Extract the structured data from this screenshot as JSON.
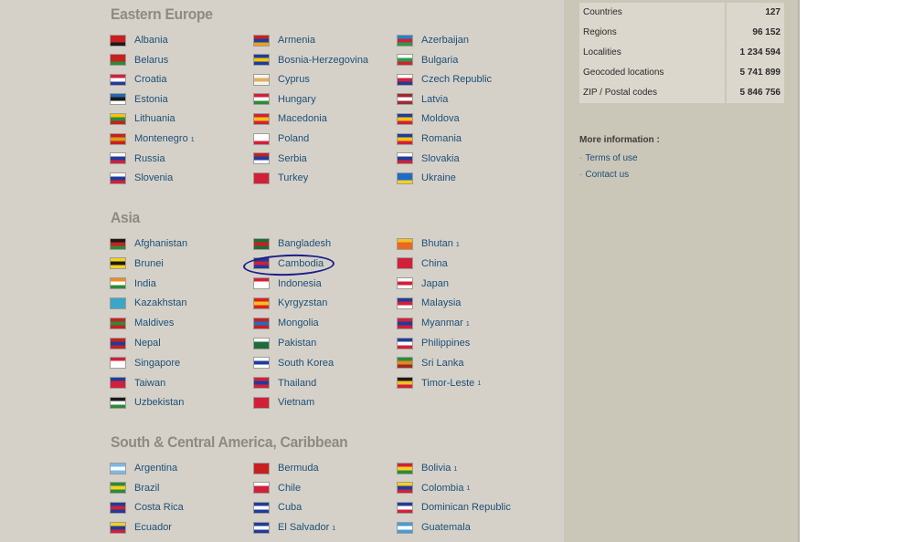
{
  "sections": [
    {
      "title": "Eastern Europe",
      "countries": [
        {
          "name": "Albania",
          "flag": "albania-flag-icon",
          "colors": [
            "#c8201e",
            "#c8201e",
            "#1a1a1a"
          ]
        },
        {
          "name": "Armenia",
          "flag": "armenia-flag-icon",
          "colors": [
            "#c8201e",
            "#1f3c9a",
            "#e8a020"
          ]
        },
        {
          "name": "Azerbaijan",
          "flag": "azerbaijan-flag-icon",
          "colors": [
            "#1f86c6",
            "#d1203a",
            "#2c9a47"
          ]
        },
        {
          "name": "Belarus",
          "flag": "belarus-flag-icon",
          "colors": [
            "#c8201e",
            "#c8201e",
            "#2c8a3a"
          ]
        },
        {
          "name": "Bosnia-Herzegovina",
          "flag": "bosnia-flag-icon",
          "colors": [
            "#1f3c9a",
            "#f1c40f",
            "#1f3c9a"
          ]
        },
        {
          "name": "Bulgaria",
          "flag": "bulgaria-flag-icon",
          "colors": [
            "#ffffff",
            "#2c9a47",
            "#d1203a"
          ]
        },
        {
          "name": "Croatia",
          "flag": "croatia-flag-icon",
          "colors": [
            "#d1203a",
            "#ffffff",
            "#1f3c9a"
          ]
        },
        {
          "name": "Cyprus",
          "flag": "cyprus-flag-icon",
          "colors": [
            "#f5f5ef",
            "#e0b060",
            "#f5f5ef"
          ]
        },
        {
          "name": "Czech Republic",
          "flag": "czech-flag-icon",
          "colors": [
            "#ffffff",
            "#d1203a",
            "#1f3c9a"
          ]
        },
        {
          "name": "Estonia",
          "flag": "estonia-flag-icon",
          "colors": [
            "#1f6cb4",
            "#1a1a1a",
            "#ffffff"
          ]
        },
        {
          "name": "Hungary",
          "flag": "hungary-flag-icon",
          "colors": [
            "#d1203a",
            "#ffffff",
            "#2c8a3a"
          ]
        },
        {
          "name": "Latvia",
          "flag": "latvia-flag-icon",
          "colors": [
            "#9b2a32",
            "#ffffff",
            "#9b2a32"
          ]
        },
        {
          "name": "Lithuania",
          "flag": "lithuania-flag-icon",
          "colors": [
            "#f1c40f",
            "#2c8a3a",
            "#c8201e"
          ]
        },
        {
          "name": "Macedonia",
          "flag": "macedonia-flag-icon",
          "colors": [
            "#d1203a",
            "#f1c40f",
            "#d1203a"
          ]
        },
        {
          "name": "Moldova",
          "flag": "moldova-flag-icon",
          "colors": [
            "#1f3c9a",
            "#f1c40f",
            "#d1203a"
          ]
        },
        {
          "name": "Montenegro",
          "sup": "1",
          "flag": "montenegro-flag-icon",
          "colors": [
            "#c8201e",
            "#d4a017",
            "#c8201e"
          ]
        },
        {
          "name": "Poland",
          "flag": "poland-flag-icon",
          "colors": [
            "#ffffff",
            "#ffffff",
            "#d1203a"
          ]
        },
        {
          "name": "Romania",
          "flag": "romania-flag-icon",
          "colors": [
            "#1f3c9a",
            "#f1c40f",
            "#d1203a"
          ]
        },
        {
          "name": "Russia",
          "flag": "russia-flag-icon",
          "colors": [
            "#ffffff",
            "#1f3c9a",
            "#d1203a"
          ]
        },
        {
          "name": "Serbia",
          "flag": "serbia-flag-icon",
          "colors": [
            "#c8201e",
            "#1f3c9a",
            "#ffffff"
          ]
        },
        {
          "name": "Slovakia",
          "flag": "slovakia-flag-icon",
          "colors": [
            "#ffffff",
            "#1f3c9a",
            "#d1203a"
          ]
        },
        {
          "name": "Slovenia",
          "flag": "slovenia-flag-icon",
          "colors": [
            "#ffffff",
            "#1f3c9a",
            "#d1203a"
          ]
        },
        {
          "name": "Turkey",
          "flag": "turkey-flag-icon",
          "colors": [
            "#d1203a",
            "#d1203a",
            "#d1203a"
          ]
        },
        {
          "name": "Ukraine",
          "flag": "ukraine-flag-icon",
          "colors": [
            "#1f6cc6",
            "#1f6cc6",
            "#f5d020"
          ]
        }
      ]
    },
    {
      "title": "Asia",
      "countries": [
        {
          "name": "Afghanistan",
          "flag": "afghanistan-flag-icon",
          "colors": [
            "#1a1a1a",
            "#c8201e",
            "#2c8a3a"
          ]
        },
        {
          "name": "Bangladesh",
          "flag": "bangladesh-flag-icon",
          "colors": [
            "#1f6b3a",
            "#c8201e",
            "#1f6b3a"
          ]
        },
        {
          "name": "Bhutan",
          "sup": "1",
          "flag": "bhutan-flag-icon",
          "colors": [
            "#f5c020",
            "#e86a20",
            "#e86a20"
          ]
        },
        {
          "name": "Brunei",
          "flag": "brunei-flag-icon",
          "colors": [
            "#f5d020",
            "#1a1a1a",
            "#f5d020"
          ]
        },
        {
          "name": "Cambodia",
          "flag": "cambodia-flag-icon",
          "colors": [
            "#1f3c9a",
            "#d1203a",
            "#1f3c9a"
          ]
        },
        {
          "name": "China",
          "flag": "china-flag-icon",
          "colors": [
            "#d1203a",
            "#d1203a",
            "#d1203a"
          ]
        },
        {
          "name": "India",
          "flag": "india-flag-icon",
          "colors": [
            "#f08a20",
            "#ffffff",
            "#2c8a3a"
          ]
        },
        {
          "name": "Indonesia",
          "flag": "indonesia-flag-icon",
          "colors": [
            "#d1203a",
            "#ffffff",
            "#ffffff"
          ]
        },
        {
          "name": "Japan",
          "flag": "japan-flag-icon",
          "colors": [
            "#ffffff",
            "#d1203a",
            "#ffffff"
          ]
        },
        {
          "name": "Kazakhstan",
          "flag": "kazakhstan-flag-icon",
          "colors": [
            "#3aa6c8",
            "#3aa6c8",
            "#3aa6c8"
          ]
        },
        {
          "name": "Kyrgyzstan",
          "flag": "kyrgyzstan-flag-icon",
          "colors": [
            "#e0201e",
            "#f5c020",
            "#e0201e"
          ]
        },
        {
          "name": "Malaysia",
          "flag": "malaysia-flag-icon",
          "colors": [
            "#1f3c9a",
            "#d1203a",
            "#ffffff"
          ]
        },
        {
          "name": "Maldives",
          "flag": "maldives-flag-icon",
          "colors": [
            "#c8201e",
            "#2c8a3a",
            "#c8201e"
          ]
        },
        {
          "name": "Mongolia",
          "flag": "mongolia-flag-icon",
          "colors": [
            "#c8201e",
            "#1f6cc6",
            "#c8201e"
          ]
        },
        {
          "name": "Myanmar",
          "sup": "1",
          "flag": "myanmar-flag-icon",
          "colors": [
            "#d1203a",
            "#1f3c9a",
            "#d1203a"
          ]
        },
        {
          "name": "Nepal",
          "flag": "nepal-flag-icon",
          "colors": [
            "#c8201e",
            "#1f3c9a",
            "#c8201e"
          ]
        },
        {
          "name": "Pakistan",
          "flag": "pakistan-flag-icon",
          "colors": [
            "#ffffff",
            "#1f6b3a",
            "#1f6b3a"
          ]
        },
        {
          "name": "Philippines",
          "flag": "philippines-flag-icon",
          "colors": [
            "#1f3c9a",
            "#ffffff",
            "#d1203a"
          ]
        },
        {
          "name": "Singapore",
          "flag": "singapore-flag-icon",
          "colors": [
            "#d1203a",
            "#ffffff",
            "#ffffff"
          ]
        },
        {
          "name": "South Korea",
          "flag": "south-korea-flag-icon",
          "colors": [
            "#ffffff",
            "#1f3c9a",
            "#ffffff"
          ]
        },
        {
          "name": "Sri Lanka",
          "flag": "sri-lanka-flag-icon",
          "colors": [
            "#2c8a3a",
            "#e08a20",
            "#9b2a22"
          ]
        },
        {
          "name": "Taiwan",
          "flag": "taiwan-flag-icon",
          "colors": [
            "#1f3c9a",
            "#d1203a",
            "#d1203a"
          ]
        },
        {
          "name": "Thailand",
          "flag": "thailand-flag-icon",
          "colors": [
            "#d1203a",
            "#1f3c9a",
            "#d1203a"
          ]
        },
        {
          "name": "Timor-Leste",
          "sup": "1",
          "flag": "timor-leste-flag-icon",
          "colors": [
            "#1a1a1a",
            "#f5c020",
            "#d1203a"
          ]
        },
        {
          "name": "Uzbekistan",
          "flag": "uzbekistan-flag-icon",
          "colors": [
            "#1a1a1a",
            "#ffffff",
            "#2c8a3a"
          ]
        },
        {
          "name": "Vietnam",
          "flag": "vietnam-flag-icon",
          "colors": [
            "#d1203a",
            "#d1203a",
            "#d1203a"
          ]
        }
      ]
    },
    {
      "title": "South & Central America, Caribbean",
      "countries": [
        {
          "name": "Argentina",
          "flag": "argentina-flag-icon",
          "colors": [
            "#7ab8e8",
            "#ffffff",
            "#7ab8e8"
          ]
        },
        {
          "name": "Bermuda",
          "flag": "bermuda-flag-icon",
          "colors": [
            "#c8201e",
            "#c8201e",
            "#c8201e"
          ]
        },
        {
          "name": "Bolivia",
          "sup": "1",
          "flag": "bolivia-flag-icon",
          "colors": [
            "#d1203a",
            "#f5d020",
            "#2c8a3a"
          ]
        },
        {
          "name": "Brazil",
          "flag": "brazil-flag-icon",
          "colors": [
            "#2c8a3a",
            "#f5d020",
            "#2c8a3a"
          ]
        },
        {
          "name": "Chile",
          "flag": "chile-flag-icon",
          "colors": [
            "#ffffff",
            "#d1203a",
            "#d1203a"
          ]
        },
        {
          "name": "Colombia",
          "sup": "1",
          "flag": "colombia-flag-icon",
          "colors": [
            "#f5d020",
            "#1f3c9a",
            "#d1203a"
          ]
        },
        {
          "name": "Costa Rica",
          "flag": "costa-rica-flag-icon",
          "colors": [
            "#1f3c9a",
            "#d1203a",
            "#1f3c9a"
          ]
        },
        {
          "name": "Cuba",
          "flag": "cuba-flag-icon",
          "colors": [
            "#1f3c9a",
            "#ffffff",
            "#1f3c9a"
          ]
        },
        {
          "name": "Dominican Republic",
          "flag": "dominican-republic-flag-icon",
          "colors": [
            "#1f3c9a",
            "#ffffff",
            "#d1203a"
          ]
        },
        {
          "name": "Ecuador",
          "flag": "ecuador-flag-icon",
          "colors": [
            "#f5d020",
            "#1f3c9a",
            "#d1203a"
          ]
        },
        {
          "name": "El Salvador",
          "sup": "1",
          "flag": "el-salvador-flag-icon",
          "colors": [
            "#1f3c9a",
            "#ffffff",
            "#1f3c9a"
          ]
        },
        {
          "name": "Guatemala",
          "flag": "guatemala-flag-icon",
          "colors": [
            "#4a9ad8",
            "#ffffff",
            "#4a9ad8"
          ]
        }
      ]
    }
  ],
  "stats": [
    {
      "label": "Countries",
      "value": "127"
    },
    {
      "label": "Regions",
      "value": "96 152"
    },
    {
      "label": "Localities",
      "value": "1 234 594"
    },
    {
      "label": "Geocoded locations",
      "value": "5 741 899"
    },
    {
      "label": "ZIP / Postal codes",
      "value": "5 846 756"
    }
  ],
  "more_info": {
    "title": "More information :",
    "links": [
      "Terms of use",
      "Contact us"
    ]
  },
  "highlight_color": "#1a1f8a"
}
